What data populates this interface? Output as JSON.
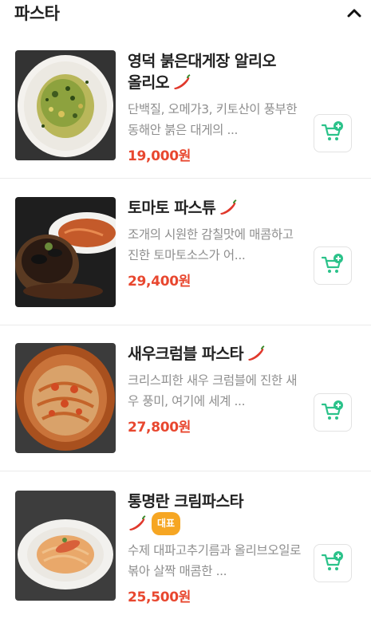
{
  "section": {
    "title": "파스타"
  },
  "items": [
    {
      "name_line1": "영덕 붉은대게장 알리오",
      "name_line2": "올리오",
      "description": "단백질, 오메가3, 키토산이 풍부한 동해안 붉은 대게의 ...",
      "price": "19,000원",
      "spicy": true
    },
    {
      "name_line1": "토마토 파스튜",
      "description": "조개의 시원한 감칠맛에 매콤하고 진한 토마토소스가 어...",
      "price": "29,400원",
      "spicy": true
    },
    {
      "name_line1": "새우크럼블 파스타",
      "description": "크리스피한 새우 크럼블에 진한 새우 풍미, 여기에 세계 ...",
      "price": "27,800원",
      "spicy": true
    },
    {
      "name_line1": "통명란 크림파스타",
      "badge": "대표",
      "description": "수제 대파고추기름과 올리브오일로 볶아 살짝 매콤한 ...",
      "price": "25,500원",
      "spicy": true
    }
  ],
  "colors": {
    "price": "#e8472f",
    "cart_icon": "#2bc28a",
    "badge": "#f6a623",
    "pepper": "#e0382b"
  }
}
